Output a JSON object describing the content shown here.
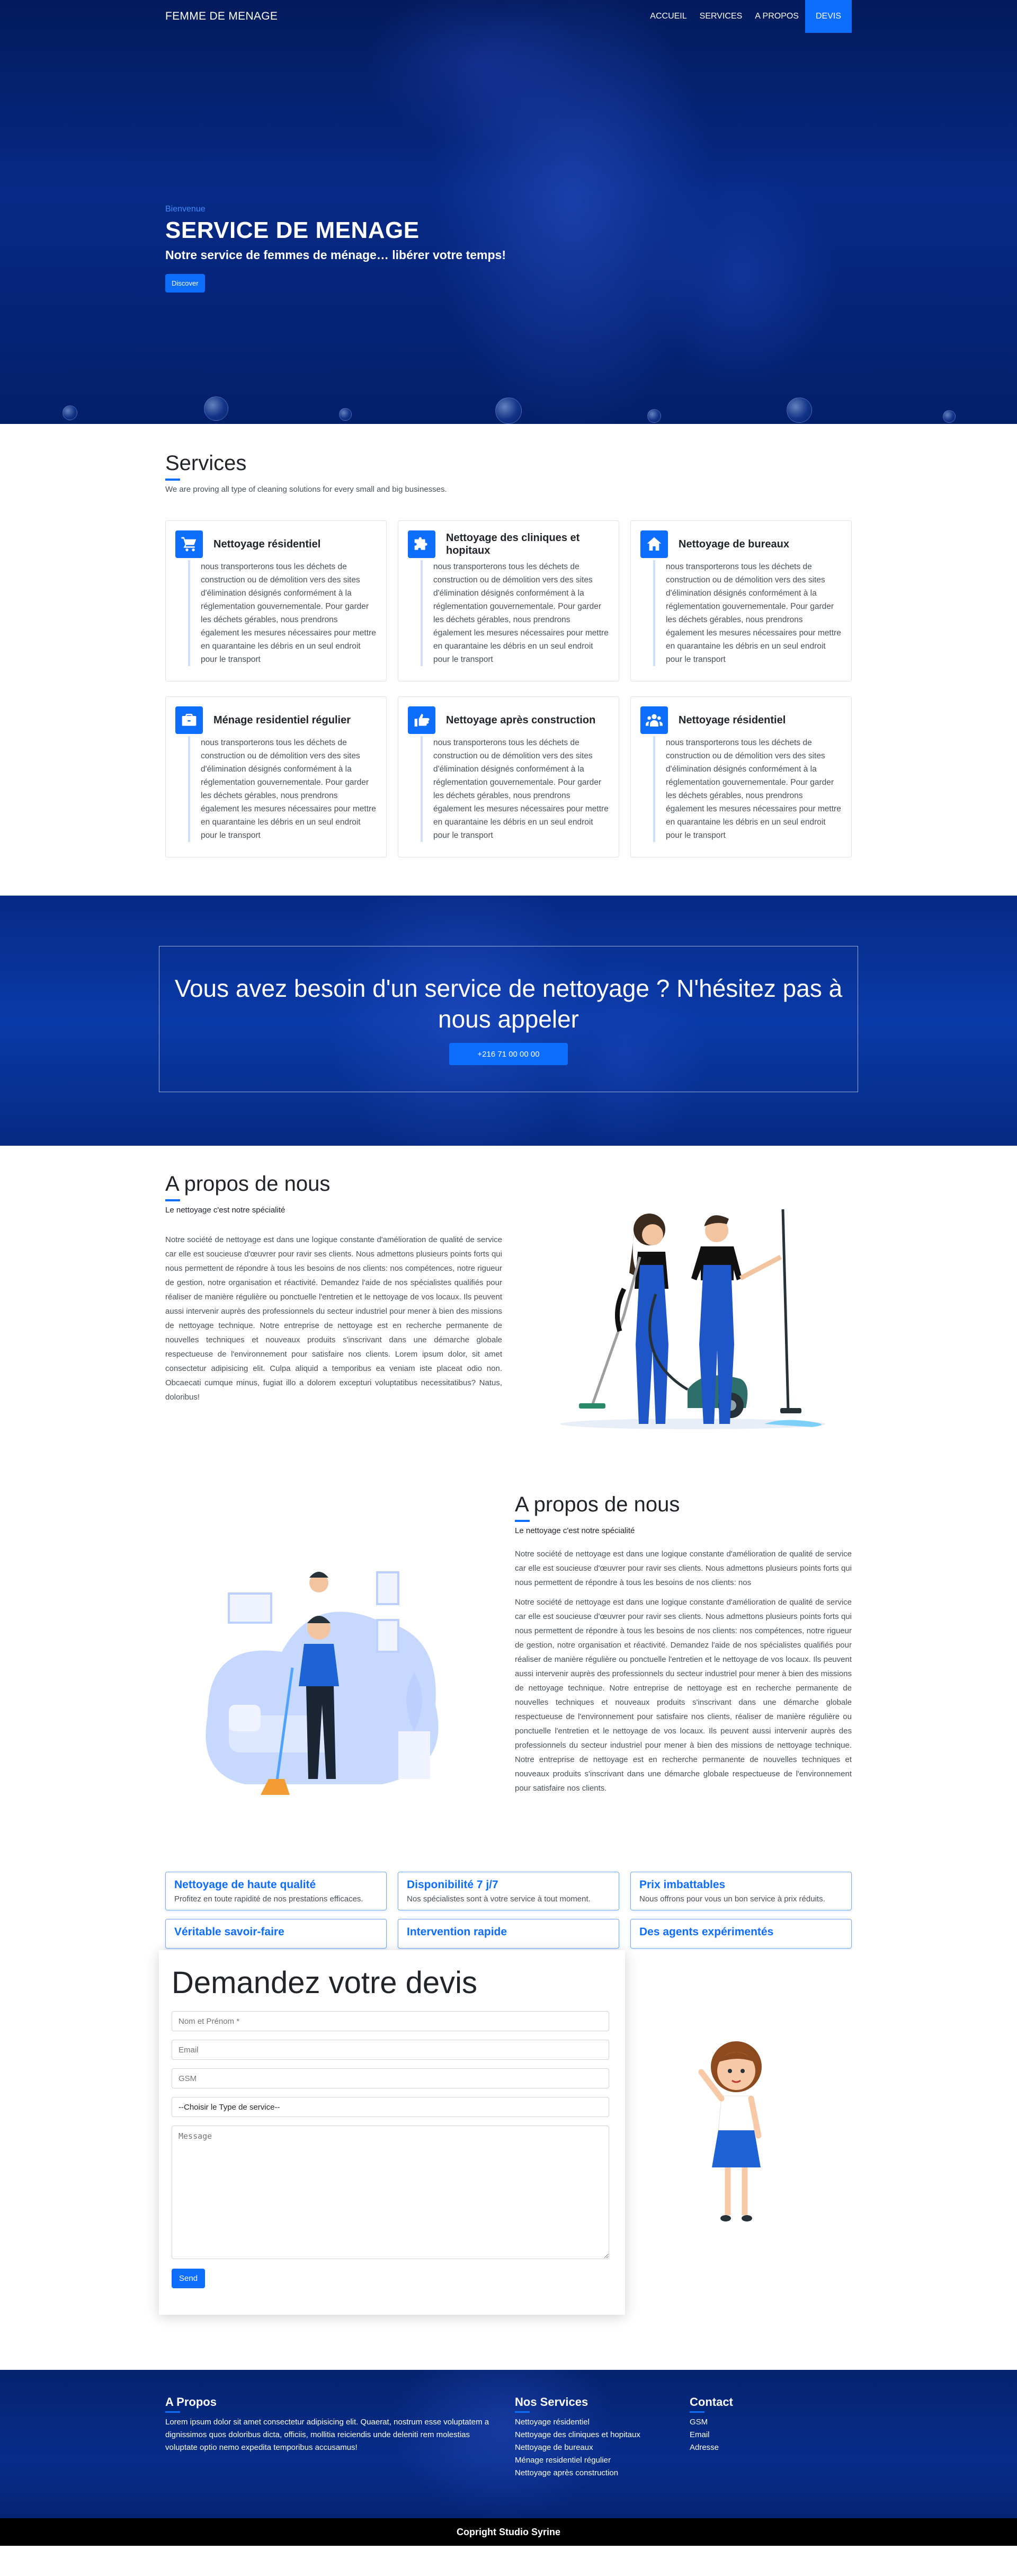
{
  "nav": {
    "brand": "FEMME DE MENAGE",
    "links": [
      "ACCUEIL",
      "SERVICES",
      "A PROPOS",
      "DEVIS"
    ]
  },
  "hero": {
    "eyebrow": "Bienvenue",
    "title": "SERVICE DE MENAGE",
    "subtitle": "Notre service de femmes de ménage… libérer votre temps!",
    "button": "Discover"
  },
  "services": {
    "title": "Services",
    "description": "We are proving all type of cleaning solutions for every small and big businesses.",
    "items": [
      {
        "icon": "cart-icon",
        "title": "Nettoyage résidentiel",
        "text": "nous transporterons tous les déchets de construction ou de démolition vers des sites d'élimination désignés conformément à la réglementation gouvernementale. Pour garder les déchets gérables, nous prendrons également les mesures nécessaires pour mettre en quarantaine les débris en un seul endroit pour le transport"
      },
      {
        "icon": "puzzle-icon",
        "title": "Nettoyage des cliniques et hopitaux",
        "text": "nous transporterons tous les déchets de construction ou de démolition vers des sites d'élimination désignés conformément à la réglementation gouvernementale. Pour garder les déchets gérables, nous prendrons également les mesures nécessaires pour mettre en quarantaine les débris en un seul endroit pour le transport"
      },
      {
        "icon": "house-icon",
        "title": "Nettoyage de bureaux",
        "text": "nous transporterons tous les déchets de construction ou de démolition vers des sites d'élimination désignés conformément à la réglementation gouvernementale. Pour garder les déchets gérables, nous prendrons également les mesures nécessaires pour mettre en quarantaine les débris en un seul endroit pour le transport"
      },
      {
        "icon": "briefcase-icon",
        "title": "Ménage residentiel régulier",
        "text": "nous transporterons tous les déchets de construction ou de démolition vers des sites d'élimination désignés conformément à la réglementation gouvernementale. Pour garder les déchets gérables, nous prendrons également les mesures nécessaires pour mettre en quarantaine les débris en un seul endroit pour le transport"
      },
      {
        "icon": "hand-pointing-icon",
        "title": "Nettoyage après construction",
        "text": "nous transporterons tous les déchets de construction ou de démolition vers des sites d'élimination désignés conformément à la réglementation gouvernementale. Pour garder les déchets gérables, nous prendrons également les mesures nécessaires pour mettre en quarantaine les débris en un seul endroit pour le transport"
      },
      {
        "icon": "people-icon",
        "title": "Nettoyage résidentiel",
        "text": "nous transporterons tous les déchets de construction ou de démolition vers des sites d'élimination désignés conformément à la réglementation gouvernementale. Pour garder les déchets gérables, nous prendrons également les mesures nécessaires pour mettre en quarantaine les débris en un seul endroit pour le transport"
      }
    ]
  },
  "cta": {
    "title": "Vous avez besoin d'un service de nettoyage ? N'hésitez pas à nous appeler",
    "phone": "+216 71 00 00 00"
  },
  "about1": {
    "title": "A propos de nous",
    "subtitle": "Le nettoyage c'est notre spécialité",
    "text": "Notre société de nettoyage est dans une logique constante d'amélioration de qualité de service car elle est soucieuse d'œuvrer pour ravir ses clients. Nous admettons plusieurs points forts qui nous permettent de répondre à tous les besoins de nos clients: nos compétences, notre rigueur de gestion, notre organisation et réactivité. Demandez l'aide de nos spécialistes qualifiés pour réaliser de manière régulière ou ponctuelle l'entretien et le nettoyage de vos locaux. Ils peuvent aussi intervenir auprès des professionnels du secteur industriel pour mener à bien des missions de nettoyage technique. Notre entreprise de nettoyage est en recherche permanente de nouvelles techniques et nouveaux produits s'inscrivant dans une démarche globale respectueuse de l'environnement pour satisfaire nos clients. Lorem ipsum dolor, sit amet consectetur adipisicing elit. Culpa aliquid a temporibus ea veniam iste placeat odio non. Obcaecati cumque minus, fugiat illo a dolorem excepturi voluptatibus necessitatibus? Natus, doloribus!"
  },
  "about2": {
    "title": "A propos de nous",
    "subtitle": "Le nettoyage c'est notre spécialité",
    "text1": "Notre société de nettoyage est dans une logique constante d'amélioration de qualité de service car elle est soucieuse d'œuvrer pour ravir ses clients. Nous admettons plusieurs points forts qui nous permettent de répondre à tous les besoins de nos clients: nos",
    "text2": "Notre société de nettoyage est dans une logique constante d'amélioration de qualité de service car elle est soucieuse d'œuvrer pour ravir ses clients. Nous admettons plusieurs points forts qui nous permettent de répondre à tous les besoins de nos clients: nos compétences, notre rigueur de gestion, notre organisation et réactivité. Demandez l'aide de nos spécialistes qualifiés pour réaliser de manière régulière ou ponctuelle l'entretien et le nettoyage de vos locaux. Ils peuvent aussi intervenir auprès des professionnels du secteur industriel pour mener à bien des missions de nettoyage technique. Notre entreprise de nettoyage est en recherche permanente de nouvelles techniques et nouveaux produits s'inscrivant dans une démarche globale respectueuse de l'environnement pour satisfaire nos clients, réaliser de manière régulière ou ponctuelle l'entretien et le nettoyage de vos locaux. Ils peuvent aussi intervenir auprès des professionnels du secteur industriel pour mener à bien des missions de nettoyage technique. Notre entreprise de nettoyage est en recherche permanente de nouvelles techniques et nouveaux produits s'inscrivant dans une démarche globale respectueuse de l'environnement pour satisfaire nos clients."
  },
  "features": [
    {
      "title": "Nettoyage de haute qualité",
      "text": "Profitez en toute rapidité de nos prestations efficaces."
    },
    {
      "title": "Disponibilité 7 j/7",
      "text": "Nos spécialistes sont à votre service à tout moment."
    },
    {
      "title": "Prix imbattables",
      "text": "Nous offrons pour vous un bon service à prix réduits."
    },
    {
      "title": "Véritable savoir-faire",
      "text": ""
    },
    {
      "title": "Intervention rapide",
      "text": ""
    },
    {
      "title": "Des agents expérimentés",
      "text": ""
    }
  ],
  "quote": {
    "title": "Demandez votre devis",
    "name_placeholder": "Nom et Prénom *",
    "email_placeholder": "Email",
    "gsm_placeholder": "GSM",
    "service_select": "--Choisir le Type de service--",
    "message_placeholder": "Message",
    "send": "Send"
  },
  "footer": {
    "about_title": "A Propos",
    "about_text": "Lorem ipsum dolor sit amet consectetur adipisicing elit. Quaerat, nostrum esse voluptatem a dignissimos quos doloribus dicta, officiis, mollitia reiciendis unde deleniti rem molestias voluptate optio nemo expedita temporibus accusamus!",
    "services_title": "Nos Services",
    "services": [
      "Nettoyage résidentiel",
      "Nettoyage des cliniques et hopitaux",
      "Nettoyage de bureaux",
      "Ménage residentiel régulier",
      "Nettoyage après construction"
    ],
    "contact_title": "Contact",
    "contact": [
      "GSM",
      "Email",
      "Adresse"
    ],
    "copyright": "Copright Studio Syrine"
  },
  "colors": {
    "primary": "#0d6efd",
    "hero_dark": "#041a5c",
    "footer_bg": "#05236f"
  }
}
